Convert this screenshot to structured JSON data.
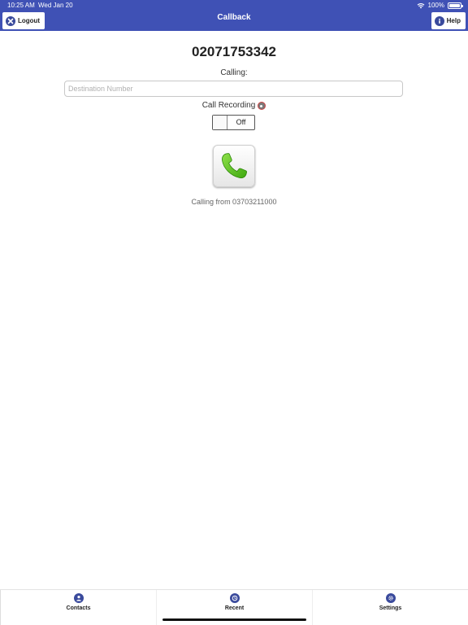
{
  "status_bar": {
    "time": "10:25 AM",
    "date": "Wed Jan 20",
    "battery": "100%"
  },
  "nav": {
    "title": "Callback",
    "logout_label": "Logout",
    "help_label": "Help"
  },
  "main": {
    "phone_number": "02071753342",
    "calling_label": "Calling:",
    "destination_placeholder": "Destination Number",
    "destination_value": "",
    "call_recording_label": "Call Recording",
    "toggle_label": "Off",
    "calling_from": "Calling from 03703211000"
  },
  "tabs": [
    {
      "label": "Contacts",
      "icon": "person-icon"
    },
    {
      "label": "Recent",
      "icon": "clock-icon"
    },
    {
      "label": "Settings",
      "icon": "gear-icon"
    }
  ],
  "colors": {
    "accent": "#3f51b5",
    "icon_blue": "#3a4a9c",
    "phone_green": "#5fc21b"
  }
}
